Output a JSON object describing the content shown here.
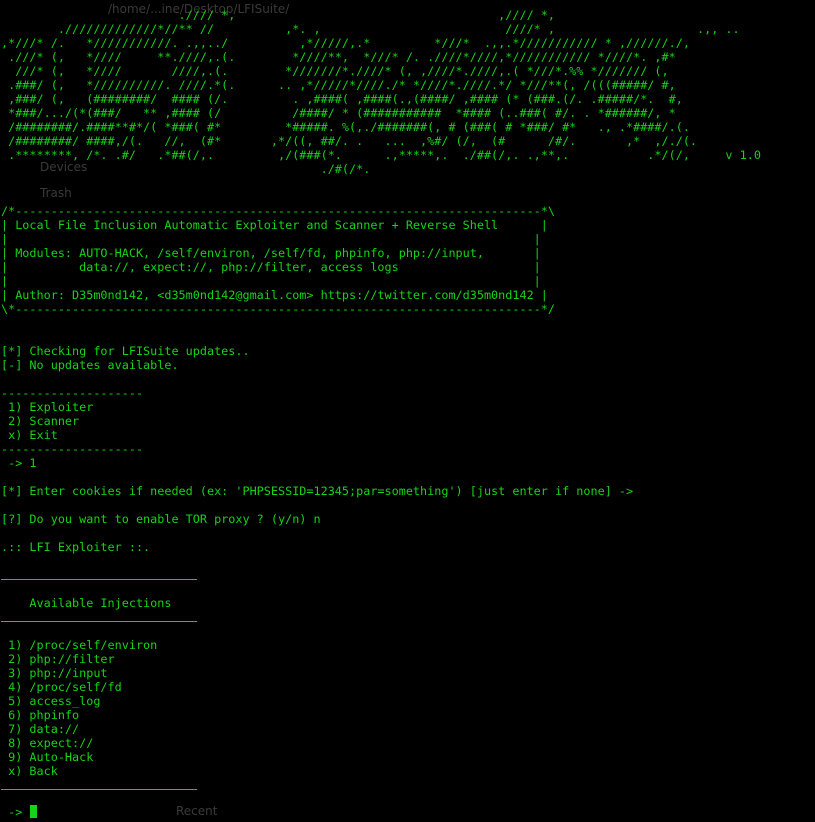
{
  "ghost": {
    "path": "/home/...ine/Desktop/LFISuite/",
    "item1": "Devices",
    "item2": "Trash",
    "bottom": "Recent"
  },
  "banner": {
    "art": [
      "                         .//// *,                                     ,//// *,",
      "        ./////////////*//** //          ,*. ,                          ////* ,                    .,, ..",
      ",*///* /.   *///////////. .,,../          ,*/////,.*         *///*  .,,.*/////////// * ,//////./,",
      " .///* (,   *////     **.////,.(.        *////**,  *///* /. .////*////,*/////////// *////*. ,#*",
      "  ///* (,   *////       ////,.(.        *///////*.////* (, ,////*.////,.( *///*.%% */////// (,",
      " .###/ (,   *//////////. ////.*(.      .. ,*/////*////./* *////*.////.*/ *///**(, /(((#####/ #,",
      " ,###/ (,   (########/  #### (/.         . ,####( ,####(.,(####/ ,#### (* (###.(/. .#####/*.  #,",
      " *###/.../(*(###/   ** ,#### (/          /####/ * (###########  *#### (..###( #/. . *######/, *",
      " /########/.####**#*/( *###( #*         *#####. %(,./#######(, # (###( # *###/ #*   ., .*####/.(.",
      " /########/ ####,/(.   //,  (#*       ,*/((, ##/. .   ...  ,%#/ (/,  (#      /#/.       ,*  ,/./(.",
      " .********, /*. .#/   .*##(/,.         ,/(###(*.      .,*****,.  ./##(/,. .,**,.           .*/(/,     v 1.0",
      "                                             ./#(/*."
    ]
  },
  "box": {
    "top": "/*--------------------------------------------------------------------------*\\",
    "title": "| Local File Inclusion Automatic Exploiter and Scanner + Reverse Shell      |",
    "blank1": "|                                                                          |",
    "modules1": "| Modules: AUTO-HACK, /self/environ, /self/fd, phpinfo, php://input,       |",
    "modules2": "|          data://, expect://, php://filter, access logs                   |",
    "blank2": "|                                                                          |",
    "author": "| Author: D35m0nd142, <d35m0nd142@gmail.com> https://twitter.com/d35m0nd142 |",
    "bottom": "\\*--------------------------------------------------------------------------*/"
  },
  "updates": {
    "checking": "[*] Checking for LFISuite updates..",
    "none": "[-] No updates available."
  },
  "menu": {
    "sep": "--------------------",
    "items": [
      " 1) Exploiter",
      " 2) Scanner",
      " x) Exit"
    ],
    "choice": " -> 1"
  },
  "prompts": {
    "cookies": "[*] Enter cookies if needed (ex: 'PHPSESSID=12345;par=something') [just enter if none] ->",
    "tor": "[?] Do you want to enable TOR proxy ? (y/n) n"
  },
  "exploiter": {
    "title": ".:: LFI Exploiter ::.",
    "injections_heading": "    Available Injections",
    "injections": [
      " 1) /proc/self/environ",
      " 2) php://filter",
      " 3) php://input",
      " 4) /proc/self/fd",
      " 5) access_log",
      " 6) phpinfo",
      " 7) data://",
      " 8) expect://",
      " 9) Auto-Hack",
      " x) Back"
    ]
  },
  "input": {
    "prompt": " -> "
  },
  "colors": {
    "text": "#17d317",
    "background": "#000000"
  }
}
